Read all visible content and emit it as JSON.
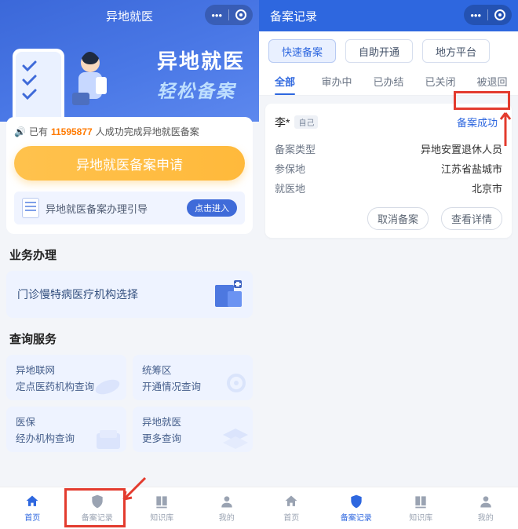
{
  "left": {
    "nav_title": "异地就医",
    "hero_line1": "异地就医",
    "hero_line2": "轻松备案",
    "success_prefix": "已有",
    "success_count": "11595877",
    "success_suffix": "人成功完成异地就医备案",
    "apply_btn": "异地就医备案申请",
    "guide_label": "异地就医备案办理引导",
    "guide_enter": "点击进入",
    "section_biz": "业务办理",
    "biz_card": "门诊慢特病医疗机构选择",
    "section_query": "查询服务",
    "q": [
      {
        "l1": "异地联网",
        "l2": "定点医药机构查询"
      },
      {
        "l1": "统筹区",
        "l2": "开通情况查询"
      },
      {
        "l1": "医保",
        "l2": "经办机构查询"
      },
      {
        "l1": "异地就医",
        "l2": "更多查询"
      }
    ],
    "tabs": [
      "首页",
      "备案记录",
      "知识库",
      "我的"
    ]
  },
  "right": {
    "nav_title": "备案记录",
    "pills": [
      "快速备案",
      "自助开通",
      "地方平台"
    ],
    "tabs": [
      "全部",
      "审办中",
      "已办结",
      "已关闭",
      "被退回"
    ],
    "record": {
      "name": "李*",
      "self": "自己",
      "status": "备案成功",
      "rows": [
        {
          "k": "备案类型",
          "v": "异地安置退休人员"
        },
        {
          "k": "参保地",
          "v": "江苏省盐城市"
        },
        {
          "k": "就医地",
          "v": "北京市"
        }
      ],
      "cancel": "取消备案",
      "detail": "查看详情"
    },
    "tabs_bottom": [
      "首页",
      "备案记录",
      "知识库",
      "我的"
    ]
  }
}
